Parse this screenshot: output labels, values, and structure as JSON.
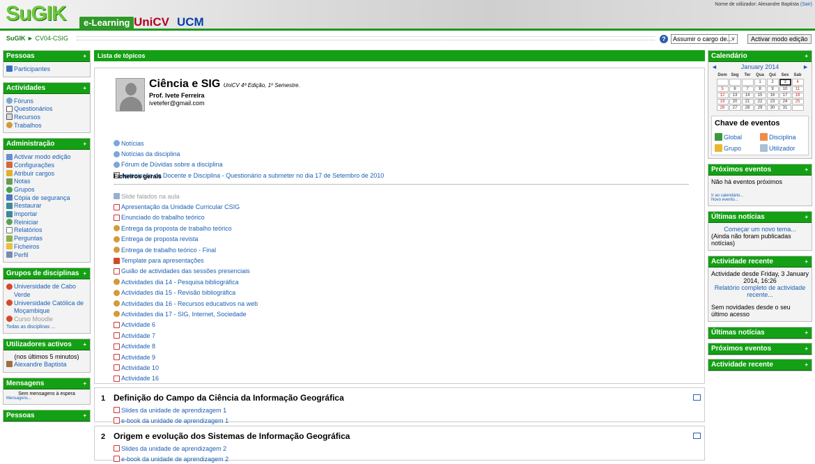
{
  "header": {
    "logo_main": "SuGIK",
    "logo_el": "e-Learning",
    "logo_unicv": "UniCV",
    "logo_ucm": "UCM",
    "user_prefix": "Nome de utilizador: Alexandre Baptista",
    "logout": "(Sair)"
  },
  "nav": {
    "home": "SuGIK",
    "sep": "►",
    "course": "CV04-CSIG",
    "help": "?",
    "role_select": "Assumir o cargo de...",
    "role_arrow": "v",
    "edit_button": "Activar modo edição"
  },
  "left": {
    "pessoas": {
      "title": "Pessoas",
      "toggle": "+",
      "items": [
        {
          "label": "Participantes"
        }
      ]
    },
    "actividades": {
      "title": "Actividades",
      "toggle": "+",
      "items": [
        {
          "label": "Fóruns"
        },
        {
          "label": "Questionários"
        },
        {
          "label": "Recursos"
        },
        {
          "label": "Trabalhos"
        }
      ]
    },
    "admin": {
      "title": "Administração",
      "toggle": "+",
      "items": [
        {
          "label": "Activar modo edição"
        },
        {
          "label": "Configurações"
        },
        {
          "label": "Atribuir cargos"
        },
        {
          "label": "Notas"
        },
        {
          "label": "Grupos"
        },
        {
          "label": "Cópia de segurança"
        },
        {
          "label": "Restaurar"
        },
        {
          "label": "Importar"
        },
        {
          "label": "Reiniciar"
        },
        {
          "label": "Relatórios"
        },
        {
          "label": "Perguntas"
        },
        {
          "label": "Ficheiros"
        },
        {
          "label": "Perfil"
        }
      ]
    },
    "grupos": {
      "title": "Grupos de disciplinas",
      "toggle": "+",
      "items": [
        {
          "l1": "Universidade de Cabo",
          "l2": "Verde"
        },
        {
          "l1": "Universidade Católica de",
          "l2": "Moçambique"
        },
        {
          "l1": "Curso Moodle",
          "l2": ""
        }
      ],
      "all": "Todas as disciplinas ..."
    },
    "utilizadores": {
      "title": "Utilizadores activos",
      "toggle": "+",
      "note": "(nos últimos 5 minutos)",
      "user": "Alexandre Baptista"
    },
    "mensagens": {
      "title": "Mensagens",
      "toggle": "+",
      "text": "Sem mensagens à espera",
      "link": "Mensagens..."
    },
    "pessoas2": {
      "title": "Pessoas",
      "toggle": "+"
    }
  },
  "main": {
    "tab": "Lista de tópicos",
    "course": {
      "title": "Ciência e SIG",
      "subtitle": "UniCV 4ª Edição, 1º Semestre.",
      "prof": "Prof. Ivete Ferreira",
      "email": "ivetefer@gmail.com"
    },
    "forums": [
      {
        "label": "Notícias",
        "icon": "forum"
      },
      {
        "label": "Notícias da disciplina",
        "icon": "forum"
      },
      {
        "label": "Fórum de Dúvidas sobre a disciplina",
        "icon": "forum"
      },
      {
        "label": "Apreciação do Docente e Disciplina - Questionário a submeter no dia 17 de Setembro de 2010",
        "icon": "quiz"
      }
    ],
    "files_head": "Ficheiros gerais",
    "files": [
      {
        "label": "Slide falados na aula",
        "icon": "resource",
        "dim": true
      },
      {
        "label": "Apresentação da Unidade Curricular CSIG",
        "icon": "pdf"
      },
      {
        "label": "Enunciado do trabalho teórico",
        "icon": "pdf"
      },
      {
        "label": "Entrega da proposta de trabalho teórico",
        "icon": "assign"
      },
      {
        "label": "Entrega de proposta revista",
        "icon": "assign"
      },
      {
        "label": "Entrega de trabalho teórico - Final",
        "icon": "assign"
      },
      {
        "label": "Template para apresentações",
        "icon": "ppt"
      },
      {
        "label": "Guião de actividades das sessões presenciais",
        "icon": "pdf"
      },
      {
        "label": "Actividades dia 14 - Pesquisa bibliográfica",
        "icon": "assign"
      },
      {
        "label": "Actividades dia 15 - Revisão bibliográfica",
        "icon": "assign"
      },
      {
        "label": "Actividades dia 16 - Recursos educativos na web",
        "icon": "assign"
      },
      {
        "label": "Actividades dia 17 - SIG, Internet, Sociedade",
        "icon": "assign"
      },
      {
        "label": "Actividade 6",
        "icon": "pdf"
      },
      {
        "label": "Actividade 7",
        "icon": "pdf"
      },
      {
        "label": "Actividade 8",
        "icon": "pdf"
      },
      {
        "label": "Actividade 9",
        "icon": "pdf"
      },
      {
        "label": "Actividade 10",
        "icon": "pdf"
      },
      {
        "label": "Actividade 16",
        "icon": "pdf"
      }
    ],
    "topics": [
      {
        "num": "1",
        "title": "Definição do Campo da Ciência da Informação Geográfica",
        "items": [
          "Slides da unidade de aprendizagem 1",
          "e-book da unidade de aprendizagem 1"
        ]
      },
      {
        "num": "2",
        "title": "Origem e evolução dos Sistemas de Informação Geográfica",
        "items": [
          "Slides da unidade de aprendizagem 2",
          "e-book da unidade de aprendizagem 2"
        ]
      }
    ]
  },
  "right": {
    "calendar": {
      "title": "Calendário",
      "toggle": "+",
      "prev": "◄",
      "next": "►",
      "month": "January 2014",
      "days": [
        "Dom",
        "Seg",
        "Ter",
        "Qua",
        "Qui",
        "Sex",
        "Sab"
      ],
      "weeks": [
        [
          "",
          "",
          "",
          "1",
          "2",
          "3",
          "4"
        ],
        [
          "5",
          "6",
          "7",
          "8",
          "9",
          "10",
          "11"
        ],
        [
          "12",
          "13",
          "14",
          "15",
          "16",
          "17",
          "18"
        ],
        [
          "19",
          "20",
          "21",
          "22",
          "23",
          "24",
          "25"
        ],
        [
          "26",
          "27",
          "28",
          "29",
          "30",
          "31",
          ""
        ]
      ],
      "key_title": "Chave de eventos",
      "keys": [
        "Global",
        "Disciplina",
        "Grupo",
        "Utilizador"
      ]
    },
    "proximos": {
      "title": "Próximos eventos",
      "toggle": "+",
      "text": "Não há eventos próximos",
      "link1": "Ir ao calendário...",
      "link2": "Novo evento..."
    },
    "noticias": {
      "title": "Últimas notícias",
      "toggle": "+",
      "link": "Começar um novo tema...",
      "text": "(Ainda não foram publicadas notícias)"
    },
    "recente": {
      "title": "Actividade recente",
      "toggle": "+",
      "since": "Actividade desde Friday, 3 January 2014, 16:26",
      "report": "Relatório completo de actividade recente...",
      "none": "Sem novidades desde o seu último acesso"
    },
    "collapsed": [
      {
        "title": "Últimas notícias",
        "toggle": "+"
      },
      {
        "title": "Próximos eventos",
        "toggle": "+"
      },
      {
        "title": "Actividade recente",
        "toggle": "+"
      }
    ]
  },
  "colors": {
    "green": "#14a014",
    "link": "#1a5fb4",
    "brand_red": "#b5001f",
    "brand_blue": "#0a3fa8"
  }
}
